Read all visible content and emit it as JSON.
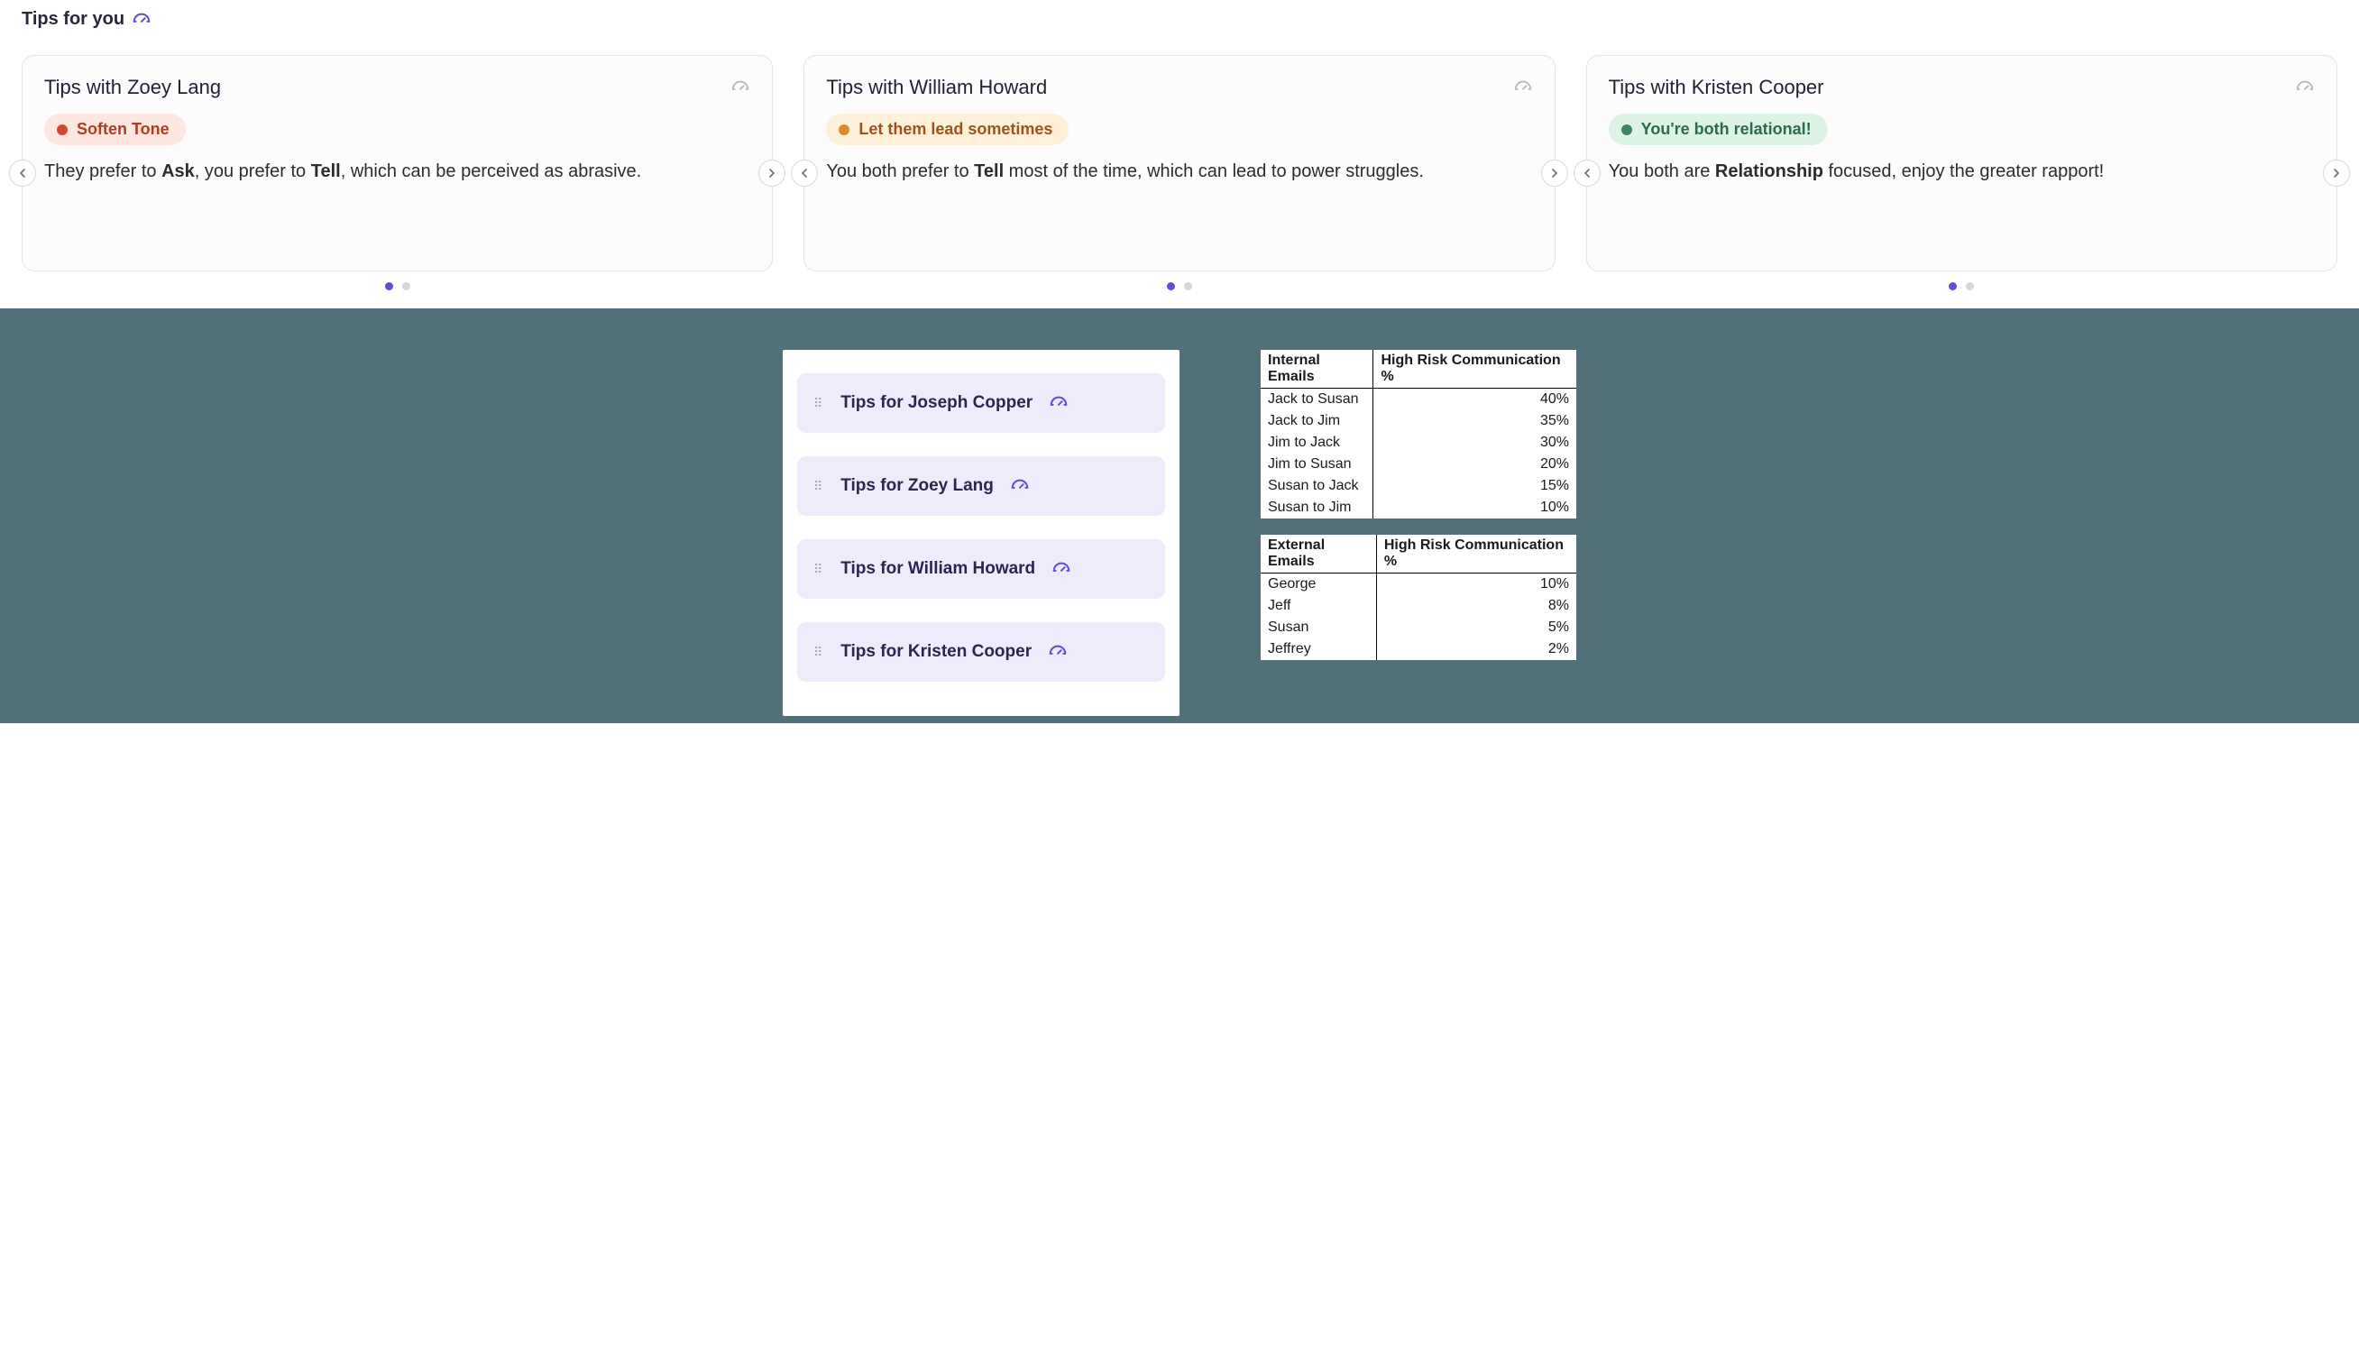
{
  "section_title": "Tips for you",
  "tip_cards": [
    {
      "title": "Tips with Zoey Lang",
      "badge_class": "red",
      "badge_label": "Soften Tone",
      "body_html": "They prefer to <b>Ask</b>, you prefer to <b>Tell</b>, which can be perceived as abrasive."
    },
    {
      "title": "Tips with William Howard",
      "badge_class": "amber",
      "badge_label": "Let them lead sometimes",
      "body_html": "You both prefer to <b>Tell</b> most of the time, which can lead to power struggles."
    },
    {
      "title": "Tips with Kristen Cooper",
      "badge_class": "green",
      "badge_label": "You're both relational!",
      "body_html": "You both are <b>Relationship</b> focused, enjoy the greater rapport!"
    }
  ],
  "tips_list": [
    "Tips for Joseph Copper",
    "Tips for Zoey Lang",
    "Tips for William Howard",
    "Tips for Kristen Cooper"
  ],
  "internal_table": {
    "col1_header": "Internal Emails",
    "col2_header": "High Risk Communication %",
    "rows": [
      {
        "label": "Jack to Susan",
        "pct": "40%"
      },
      {
        "label": "Jack to Jim",
        "pct": "35%"
      },
      {
        "label": "Jim to Jack",
        "pct": "30%"
      },
      {
        "label": "Jim to Susan",
        "pct": "20%"
      },
      {
        "label": "Susan to Jack",
        "pct": "15%"
      },
      {
        "label": "Susan to Jim",
        "pct": "10%"
      }
    ]
  },
  "external_table": {
    "col1_header": "External Emails",
    "col2_header": "High Risk Communication %",
    "rows": [
      {
        "label": "George",
        "pct": "10%"
      },
      {
        "label": "Jeff",
        "pct": "8%"
      },
      {
        "label": "Susan",
        "pct": "5%"
      },
      {
        "label": "Jeffrey",
        "pct": "2%"
      }
    ]
  },
  "chart_data": [
    {
      "type": "table",
      "title": "Internal Emails — High Risk Communication %",
      "categories": [
        "Jack to Susan",
        "Jack to Jim",
        "Jim to Jack",
        "Jim to Susan",
        "Susan to Jack",
        "Susan to Jim"
      ],
      "values": [
        40,
        35,
        30,
        20,
        15,
        10
      ],
      "ylabel": "High Risk Communication %"
    },
    {
      "type": "table",
      "title": "External Emails — High Risk Communication %",
      "categories": [
        "George",
        "Jeff",
        "Susan",
        "Jeffrey"
      ],
      "values": [
        10,
        8,
        5,
        2
      ],
      "ylabel": "High Risk Communication %"
    }
  ]
}
